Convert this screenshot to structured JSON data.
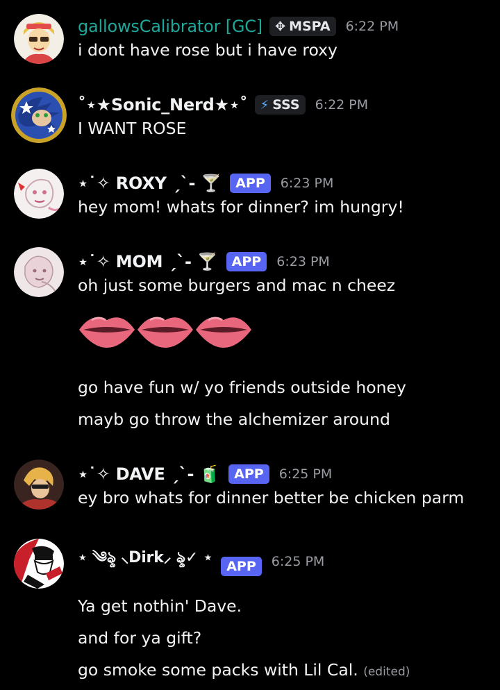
{
  "messages": [
    {
      "author": "gallowsCalibrator [GC]",
      "tag_glyph": "✥",
      "tag": "MSPA",
      "time": "6:22 PM",
      "lines": [
        "i dont have rose but i have roxy"
      ]
    },
    {
      "author": "˚⋆★Sonic_Nerd★⋆˚",
      "tag_glyph": "⚡",
      "tag": "SSS",
      "time": "6:22 PM",
      "lines": [
        "I WANT ROSE"
      ]
    },
    {
      "author": "⋆˙✧ ROXY ˏˋ-",
      "emoji": "🍸",
      "badge": "APP",
      "time": "6:23 PM",
      "lines": [
        "hey mom! whats for dinner? im hungry!"
      ]
    },
    {
      "author": "⋆˙✧ MOM ˏˋ-",
      "emoji": "🍸",
      "badge": "APP",
      "time": "6:23 PM",
      "lines": [
        "oh just some burgers and mac n cheez",
        "go have fun w/ yo friends outside honey",
        "mayb go throw the alchemizer around"
      ],
      "lips_emoji": "lips-icon"
    },
    {
      "author": "⋆˙✧ DAVE ˏˋ-",
      "emoji": "🧃",
      "badge": "APP",
      "time": "6:25 PM",
      "lines": [
        "ey bro whats for dinner better be chicken parm"
      ]
    },
    {
      "author": "⋆ ༄ৡ ⸜Dirk⸝ ৡ✓ ⋆",
      "badge": "APP",
      "time": "6:25 PM",
      "lines": [
        "Ya get nothin' Dave.",
        "and for ya gift?",
        "go smoke some packs with Lil Cal."
      ],
      "edited": "(edited)"
    }
  ],
  "colors": {
    "background": "#000000",
    "gc_name": "#1fa89a",
    "app_badge": "#5865f2",
    "timestamp": "#9a9ca3"
  }
}
